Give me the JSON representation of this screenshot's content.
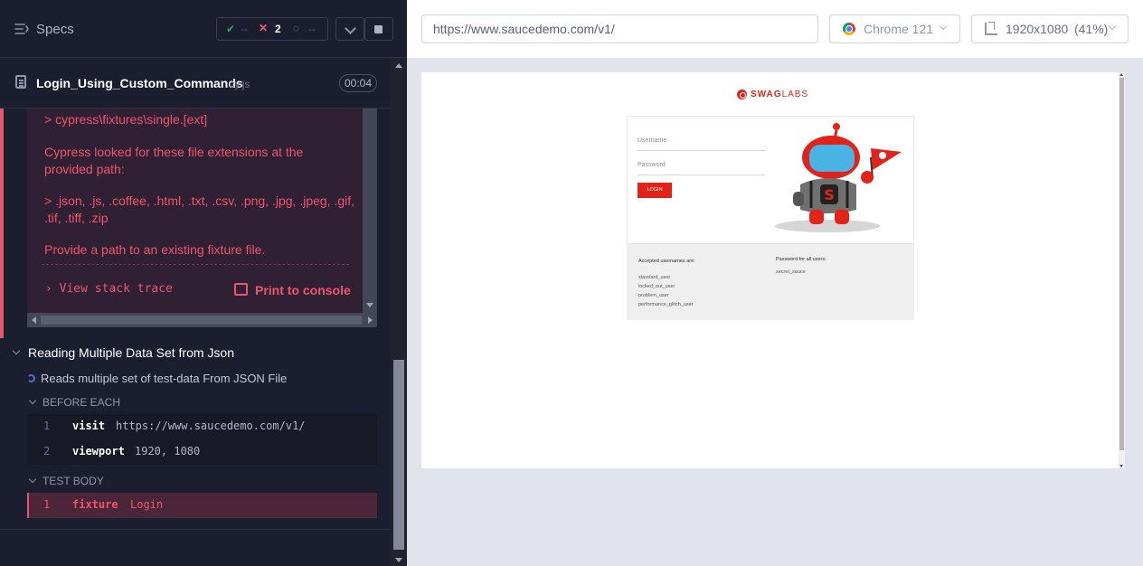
{
  "header": {
    "specs_label": "Specs",
    "stats": {
      "passed": "--",
      "failed": "2",
      "pending": "--"
    }
  },
  "spec_file": {
    "name": "Login_Using_Custom_Commands",
    "ext": ".cy.js",
    "duration": "00:04"
  },
  "error": {
    "line1": "> cypress\\fixtures\\single.[ext]",
    "line2": "Cypress looked for these file extensions at the provided path:",
    "line3": "> .json, .js, .coffee, .html, .txt, .csv, .png, .jpg, .jpeg, .gif, .tif, .tiff, .zip",
    "line4": "Provide a path to an existing fixture file.",
    "stack_trace": "View stack trace",
    "print_console": "Print to console"
  },
  "suite": {
    "title": "Reading Multiple Data Set from Json",
    "test_title": "Reads multiple set of test-data From JSON File",
    "before_each_label": "BEFORE EACH",
    "test_body_label": "TEST BODY",
    "before_each_commands": [
      {
        "num": "1",
        "name": "visit",
        "message": "https://www.saucedemo.com/v1/"
      },
      {
        "num": "2",
        "name": "viewport",
        "message": "1920, 1080"
      }
    ],
    "test_body_commands": [
      {
        "num": "1",
        "name": "fixture",
        "message": "Login"
      }
    ]
  },
  "browser_bar": {
    "url": "https://www.saucedemo.com/v1/",
    "browser": "Chrome 121",
    "viewport": "1920x1080",
    "scale": "(41%)"
  },
  "aut": {
    "logo_bold": "SWAG",
    "logo_light": "LABS",
    "username_placeholder": "Username",
    "password_placeholder": "Password",
    "login_button": "LOGIN",
    "accepted_usernames_title": "Accepted usernames are:",
    "usernames": [
      "standard_user",
      "locked_out_user",
      "problem_user",
      "performance_glitch_user"
    ],
    "password_title": "Password for all users:",
    "password": "secret_sauce"
  },
  "colors": {
    "runner_bg": "#1b1e2e",
    "error_red": "#f0546d",
    "pass_green": "#1fa971",
    "swag_red": "#e2231a"
  }
}
